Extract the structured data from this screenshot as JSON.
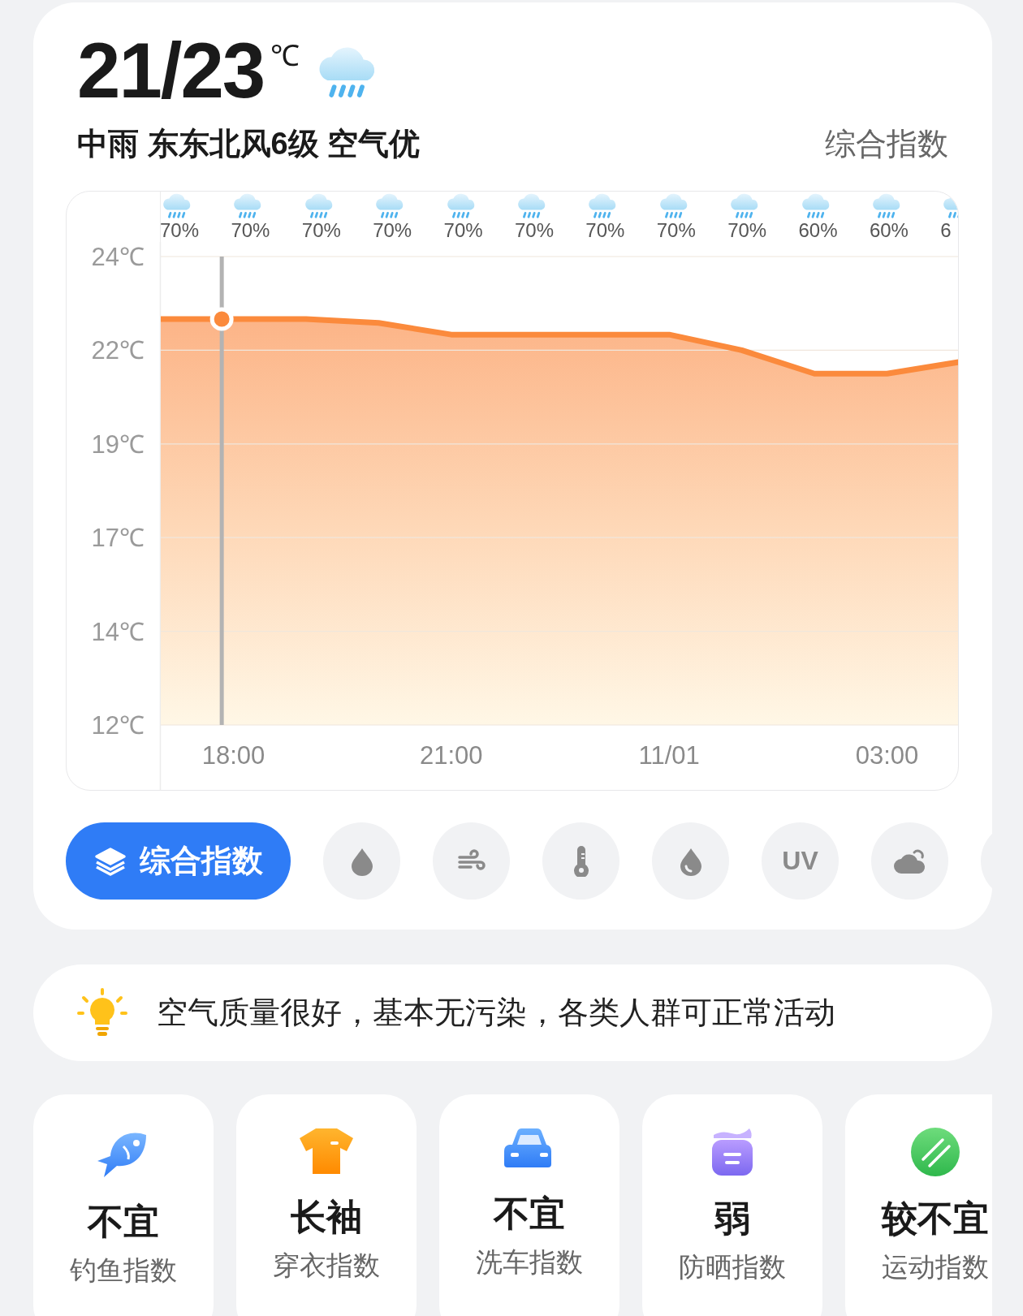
{
  "header": {
    "temperature": "21/23",
    "unit": "℃",
    "description": "中雨 东东北风6级 空气优",
    "index_link": "综合指数"
  },
  "chart": {
    "precipitation": [
      "70%",
      "70%",
      "70%",
      "70%",
      "70%",
      "70%",
      "70%",
      "70%",
      "70%",
      "60%",
      "60%",
      "6"
    ],
    "chart_data": {
      "type": "area",
      "categories": [
        null,
        "18:00",
        null,
        null,
        "21:00",
        null,
        null,
        "11/01",
        null,
        null,
        "03:00",
        null
      ],
      "series": [
        {
          "color": "#fb8a3c",
          "values": [
            22.4,
            22.4,
            22.4,
            22.3,
            22.0,
            22.0,
            22.0,
            22.0,
            21.6,
            21.0,
            21.0,
            21.3
          ]
        }
      ],
      "grid": true,
      "ylim": [
        12,
        24
      ],
      "yticks": [
        {
          "value": 24,
          "label": "24℃"
        },
        {
          "value": 21.6,
          "label": "22℃"
        },
        {
          "value": 19.2,
          "label": "19℃"
        },
        {
          "value": 16.8,
          "label": "17℃"
        },
        {
          "value": 14.4,
          "label": "14℃"
        },
        {
          "value": 12,
          "label": "12℃"
        }
      ]
    }
  },
  "index_buttons": [
    {
      "kind": "label",
      "label": "综合指数",
      "selected": true
    },
    {
      "kind": "drop",
      "selected": false
    },
    {
      "kind": "wind",
      "selected": false
    },
    {
      "kind": "thermometer",
      "selected": false
    },
    {
      "kind": "humidity",
      "selected": false
    },
    {
      "kind": "text",
      "label": "UV",
      "selected": false
    },
    {
      "kind": "cloud",
      "selected": false
    },
    {
      "kind": "blank",
      "selected": false
    }
  ],
  "tip": {
    "text": "空气质量很好，基本无污染，各类人群可正常活动"
  },
  "index_cards": [
    {
      "kind": "fish",
      "value": "不宜",
      "label": "钓鱼指数"
    },
    {
      "kind": "shirt",
      "value": "长袖",
      "label": "穿衣指数"
    },
    {
      "kind": "car",
      "value": "不宜",
      "label": "洗车指数"
    },
    {
      "kind": "jar",
      "value": "弱",
      "label": "防晒指数"
    },
    {
      "kind": "ball",
      "value": "较不宜",
      "label": "运动指数"
    }
  ]
}
